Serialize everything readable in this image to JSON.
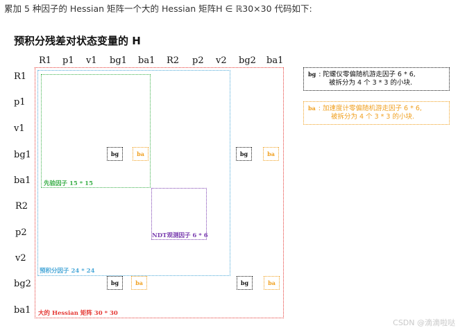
{
  "intro": "累加 5 种因子的 Hessian 矩阵一个大的 Hessian 矩阵H ∈ ℝ30×30 代码如下:",
  "heading": "预积分残差对状态变量的 H",
  "column_labels": [
    "R1",
    "p1",
    "v1",
    "bg1",
    "ba1",
    "R2",
    "p2",
    "v2",
    "bg2",
    "ba1"
  ],
  "row_labels": [
    "R1",
    "p1",
    "v1",
    "bg1",
    "ba1",
    "R2",
    "p2",
    "v2",
    "bg2",
    "ba1"
  ],
  "blocks": {
    "big": "大的 Hessian 矩阵 30 * 30",
    "preint": "预积分因子 24 * 24",
    "prior": "先验因子 15 * 15",
    "ndt": "NDT观测因子 6 * 6"
  },
  "mini_labels": {
    "bg": "bg",
    "ba": "ba"
  },
  "legend": {
    "bg_tag": "bg",
    "bg_text_line1": ": 陀螺仪零偏随机游走因子 6 * 6,",
    "bg_text_line2": "被拆分为 4 个 3 * 3 的小块.",
    "ba_tag": "ba",
    "ba_text_line1": ": 加速度计零偏随机游走因子 6 * 6,",
    "ba_text_line2": "被拆分为 4 个 3 * 3 的小块."
  },
  "watermark": "CSDN @滴滴啦哒",
  "colors": {
    "big": "#e53935",
    "preint": "#4aa8d8",
    "prior": "#3cb04a",
    "ndt": "#7b3fb0",
    "ba": "#f0a020",
    "bg": "#111111"
  }
}
